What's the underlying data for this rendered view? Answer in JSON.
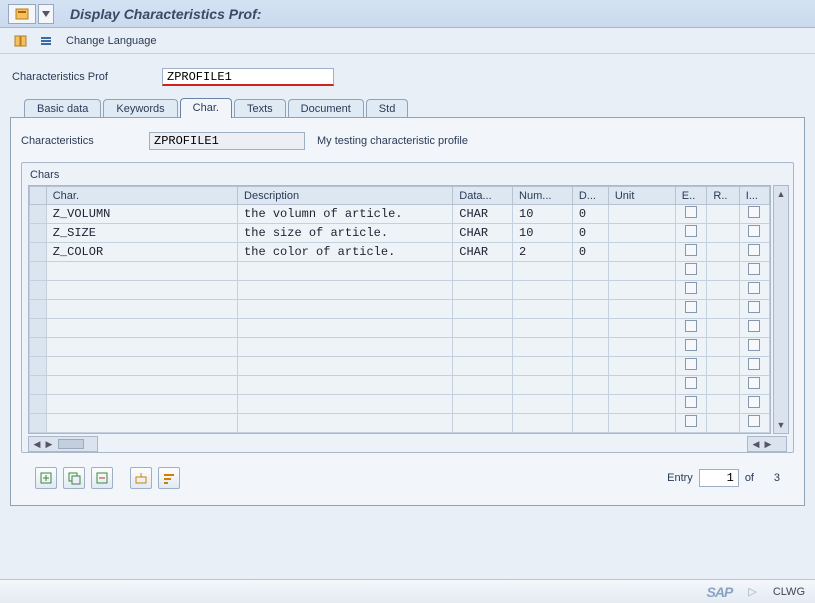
{
  "title": "Display Characteristics Prof:",
  "toolbar": {
    "change_language": "Change Language"
  },
  "profile_label": "Characteristics Prof",
  "profile_value": "ZPROFILE1",
  "tabs": [
    "Basic data",
    "Keywords",
    "Char.",
    "Texts",
    "Document",
    "Std"
  ],
  "active_tab": 2,
  "char_label": "Characteristics",
  "char_value": "ZPROFILE1",
  "char_desc": "My testing characteristic profile",
  "groupbox_title": "Chars",
  "columns": [
    "Char.",
    "Description",
    "Data...",
    "Num...",
    "D...",
    "Unit",
    "E..",
    "R..",
    "I..."
  ],
  "rows": [
    {
      "char": "Z_VOLUMN",
      "desc": "the volumn of article.",
      "dtype": "CHAR",
      "num": "10",
      "d": "0",
      "unit": ""
    },
    {
      "char": "Z_SIZE",
      "desc": "the size of article.",
      "dtype": "CHAR",
      "num": "10",
      "d": "0",
      "unit": ""
    },
    {
      "char": "Z_COLOR",
      "desc": "the color of article.",
      "dtype": "CHAR",
      "num": "2",
      "d": "0",
      "unit": ""
    }
  ],
  "empty_rows": 9,
  "entry": {
    "label": "Entry",
    "current": "1",
    "of": "of",
    "total": "3"
  },
  "status": {
    "system": "CLWG"
  }
}
